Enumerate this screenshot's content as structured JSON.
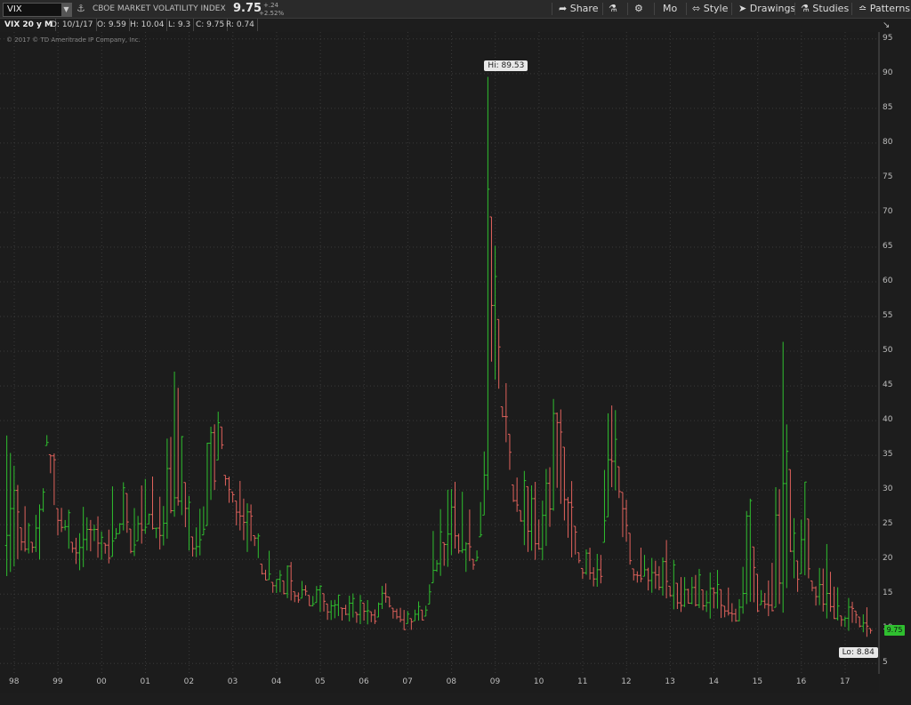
{
  "toolbar": {
    "symbol": "VIX",
    "title": "CBOE MARKET VOLATILITY INDEX",
    "last": "9.75",
    "net_change": "+.24",
    "pct_change": "+2.52%",
    "share": "Share",
    "mo": "Mo",
    "style": "Style",
    "drawings": "Drawings",
    "studies": "Studies",
    "patterns": "Patterns"
  },
  "info": {
    "label": "VIX 20 y M",
    "date": "D: 10/1/17",
    "open": "O: 9.59",
    "high": "H: 10.04",
    "low": "L: 9.3",
    "close": "C: 9.75",
    "range": "R: 0.74"
  },
  "copyright": "© 2017 © TD Ameritrade IP Company, Inc.",
  "colors": {
    "up": "#2fbf2f",
    "down": "#e0625c",
    "grid": "#3a3a3a",
    "price_tag": "#2fbf2f"
  },
  "chart_data": {
    "type": "bar",
    "subtype": "ohlc-monthly",
    "title": "VIX 20 y M",
    "ylim": [
      3.5,
      96
    ],
    "yticks": [
      5,
      10,
      15,
      20,
      25,
      30,
      35,
      40,
      45,
      50,
      55,
      60,
      65,
      70,
      75,
      80,
      85,
      90,
      95
    ],
    "ytick_labels": [
      "5",
      "10",
      "15",
      "20",
      "25",
      "30",
      "35",
      "40",
      "45",
      "50",
      "55",
      "60",
      "65",
      "70",
      "75",
      "80",
      "85",
      "90",
      "95"
    ],
    "xticks": [
      1998,
      1999,
      2000,
      2001,
      2002,
      2003,
      2004,
      2005,
      2006,
      2007,
      2008,
      2009,
      2010,
      2011,
      2012,
      2013,
      2014,
      2015,
      2016,
      2017
    ],
    "xtick_labels": [
      "98",
      "99",
      "00",
      "01",
      "02",
      "03",
      "04",
      "05",
      "06",
      "07",
      "08",
      "09",
      "10",
      "11",
      "12",
      "13",
      "14",
      "15",
      "16",
      "17"
    ],
    "grid": true,
    "last_price": "9.75",
    "hi_label": "Hi: 89.53",
    "lo_label": "Lo: 8.84",
    "hi": {
      "year": 2008.83,
      "value": 89.53
    },
    "lo": {
      "year": 2017.5,
      "value": 8.84
    },
    "anchors": [
      [
        1997.9,
        20,
        38
      ],
      [
        1998.2,
        22,
        30
      ],
      [
        1998.6,
        21,
        28
      ],
      [
        1998.75,
        40,
        49
      ],
      [
        1998.95,
        27,
        35
      ],
      [
        1999.2,
        24,
        30
      ],
      [
        1999.5,
        20,
        27
      ],
      [
        1999.8,
        23,
        30
      ],
      [
        2000.1,
        21,
        28
      ],
      [
        2000.4,
        25,
        32
      ],
      [
        2000.8,
        23,
        30
      ],
      [
        2001.1,
        27,
        33
      ],
      [
        2001.3,
        22,
        30
      ],
      [
        2001.7,
        30,
        49
      ],
      [
        2001.9,
        25,
        33
      ],
      [
        2002.2,
        20,
        27
      ],
      [
        2002.5,
        30,
        40
      ],
      [
        2002.7,
        38,
        48
      ],
      [
        2002.9,
        30,
        36
      ],
      [
        2003.1,
        28,
        35
      ],
      [
        2003.3,
        24,
        30
      ],
      [
        2003.6,
        21,
        25
      ],
      [
        2003.9,
        17,
        20
      ],
      [
        2004.2,
        16,
        20
      ],
      [
        2004.6,
        15,
        19
      ],
      [
        2004.9,
        14,
        17
      ],
      [
        2005.2,
        12,
        16
      ],
      [
        2005.5,
        12,
        15
      ],
      [
        2005.9,
        12,
        15
      ],
      [
        2006.2,
        11,
        14
      ],
      [
        2006.5,
        14,
        22
      ],
      [
        2006.8,
        11,
        14
      ],
      [
        2007.1,
        11,
        14
      ],
      [
        2007.4,
        12,
        16
      ],
      [
        2007.6,
        18,
        26
      ],
      [
        2007.9,
        20,
        31
      ],
      [
        2008.1,
        22,
        32
      ],
      [
        2008.4,
        20,
        27
      ],
      [
        2008.6,
        21,
        27
      ],
      [
        2008.75,
        30,
        48
      ],
      [
        2008.83,
        55,
        89.5
      ],
      [
        2008.95,
        50,
        68
      ],
      [
        2009.1,
        44,
        57
      ],
      [
        2009.2,
        40,
        52
      ],
      [
        2009.4,
        32,
        42
      ],
      [
        2009.6,
        26,
        35
      ],
      [
        2009.8,
        23,
        31
      ],
      [
        2010.1,
        22,
        30
      ],
      [
        2010.4,
        32,
        48
      ],
      [
        2010.6,
        25,
        38
      ],
      [
        2010.9,
        20,
        26
      ],
      [
        2011.2,
        17,
        22
      ],
      [
        2011.4,
        17,
        22
      ],
      [
        2011.6,
        30,
        48
      ],
      [
        2011.8,
        32,
        46
      ],
      [
        2011.95,
        24,
        33
      ],
      [
        2012.2,
        18,
        24
      ],
      [
        2012.4,
        18,
        26
      ],
      [
        2012.7,
        16,
        20
      ],
      [
        2012.95,
        15,
        23
      ],
      [
        2013.2,
        13,
        18
      ],
      [
        2013.5,
        14,
        20
      ],
      [
        2013.8,
        13,
        17
      ],
      [
        2014.1,
        13,
        21
      ],
      [
        2014.4,
        12,
        15
      ],
      [
        2014.6,
        12,
        17
      ],
      [
        2014.8,
        15,
        31
      ],
      [
        2015.0,
        14,
        22
      ],
      [
        2015.3,
        13,
        17
      ],
      [
        2015.6,
        14,
        53
      ],
      [
        2015.75,
        22,
        34
      ],
      [
        2015.9,
        17,
        24
      ],
      [
        2016.1,
        20,
        32
      ],
      [
        2016.3,
        14,
        18
      ],
      [
        2016.5,
        13,
        25
      ],
      [
        2016.8,
        12,
        17
      ],
      [
        2017.0,
        11,
        14
      ],
      [
        2017.3,
        11,
        16
      ],
      [
        2017.6,
        10,
        17
      ],
      [
        2017.75,
        9.3,
        10.04
      ]
    ]
  }
}
